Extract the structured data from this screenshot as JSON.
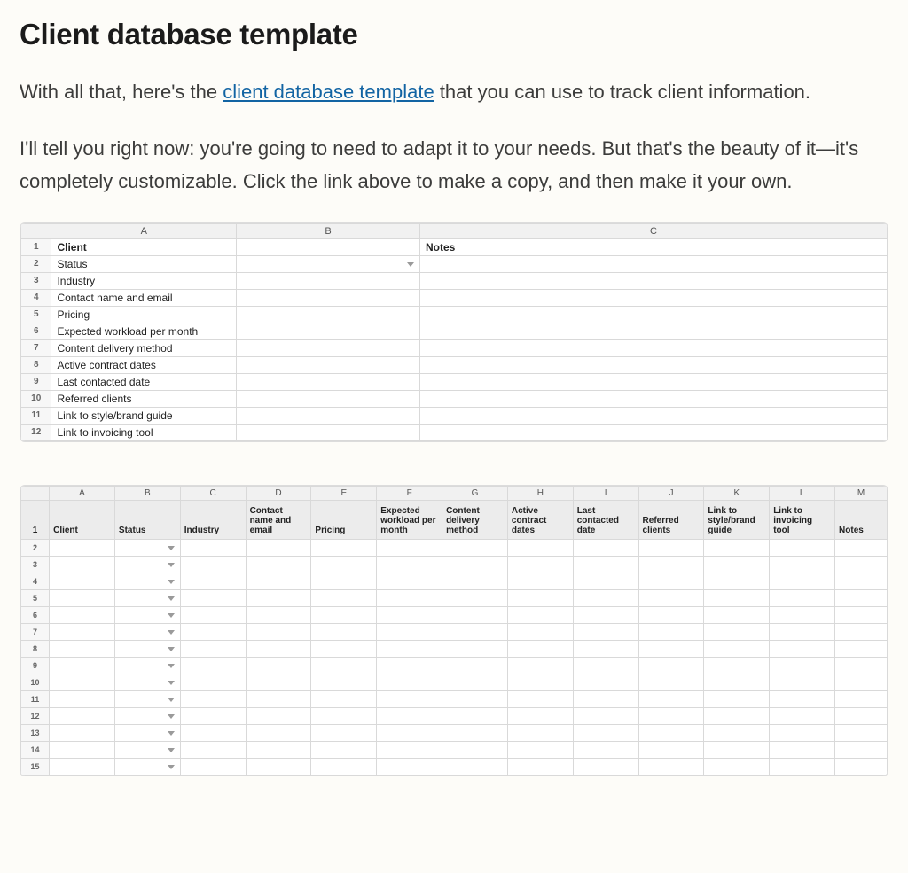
{
  "title": "Client database template",
  "para1_before": "With all that, here's the ",
  "para1_link": "client database template",
  "para1_after": " that you can use to track client information.",
  "para2": "I'll tell you right now: you're going to need to adapt it to your needs. But that's the beauty of it—it's completely customizable. Click the link above to make a copy, and then make it your own.",
  "sheet1": {
    "columns": [
      "A",
      "B",
      "C"
    ],
    "rows": [
      {
        "n": "1",
        "a": "Client",
        "a_bold": true,
        "c": "Notes",
        "c_bold": true
      },
      {
        "n": "2",
        "a": "Status",
        "b_dropdown": true
      },
      {
        "n": "3",
        "a": "Industry"
      },
      {
        "n": "4",
        "a": "Contact name and email"
      },
      {
        "n": "5",
        "a": "Pricing"
      },
      {
        "n": "6",
        "a": "Expected workload per month"
      },
      {
        "n": "7",
        "a": "Content delivery method"
      },
      {
        "n": "8",
        "a": "Active contract dates"
      },
      {
        "n": "9",
        "a": "Last contacted date"
      },
      {
        "n": "10",
        "a": "Referred clients"
      },
      {
        "n": "11",
        "a": "Link to style/brand guide"
      },
      {
        "n": "12",
        "a": "Link to invoicing tool"
      }
    ]
  },
  "sheet2": {
    "columns": [
      "A",
      "B",
      "C",
      "D",
      "E",
      "F",
      "G",
      "H",
      "I",
      "J",
      "K",
      "L",
      "M"
    ],
    "headers": [
      "Client",
      "Status",
      "Industry",
      "Contact name and email",
      "Pricing",
      "Expected workload per month",
      "Content delivery method",
      "Active contract dates",
      "Last contacted date",
      "Referred clients",
      "Link to style/brand guide",
      "Link to invoicing tool",
      "Notes"
    ],
    "row_count": 15,
    "dropdown_col": 1
  }
}
